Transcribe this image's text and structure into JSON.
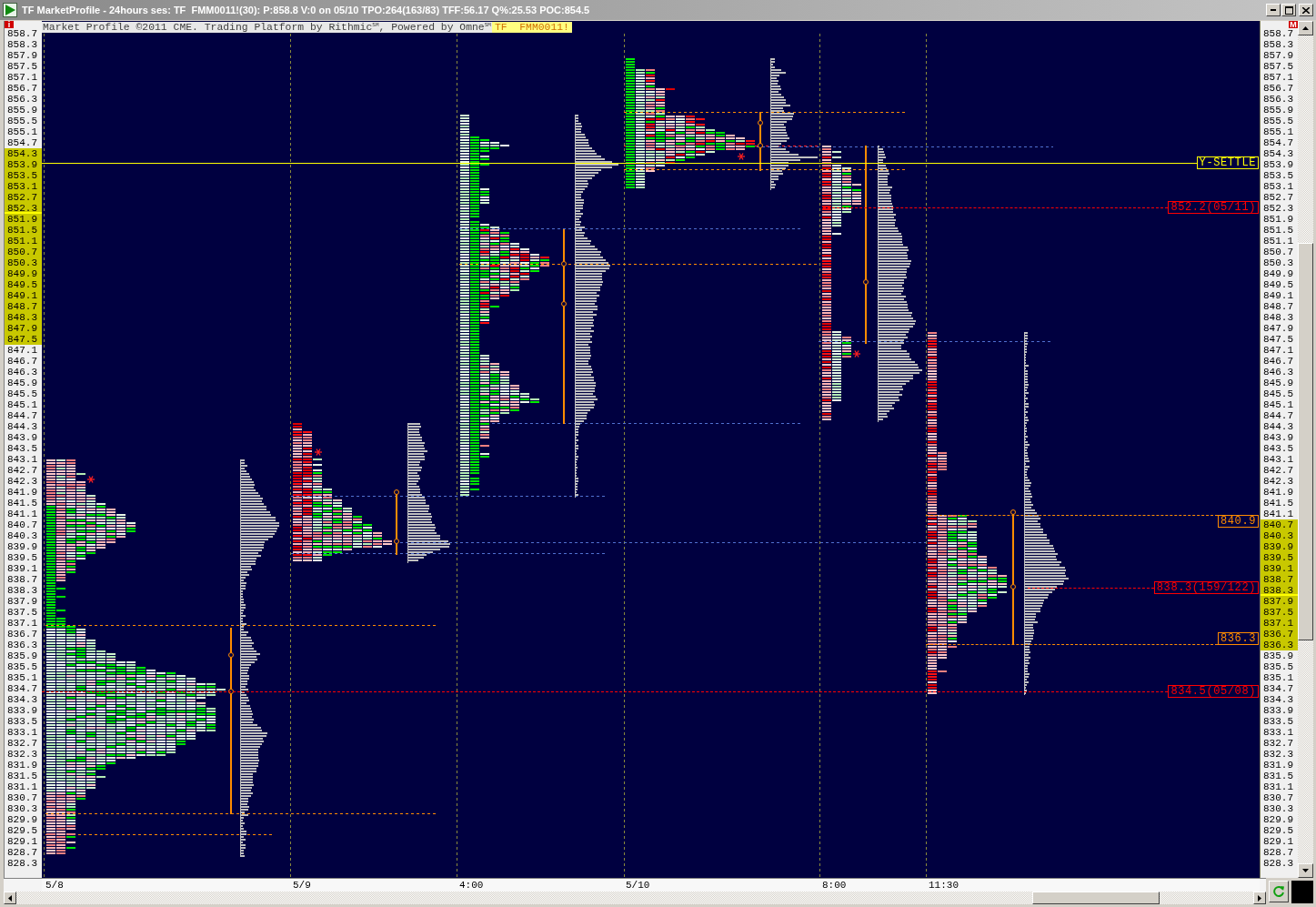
{
  "window": {
    "title": "TF MarketProfile - 24hours ses: TF  FMM0011!(30): P:858.8 V:0 on 05/10 TPO:264(163/83) TFF:56.17 Q%:25.53 POC:854.5"
  },
  "header": {
    "credit": "Market Profile ©2011 CME. Trading Platform by Rithmic$^{SM}$, Powered by Omne$^{SM}$",
    "symbol": "TF  FMM0011!"
  },
  "left_tag": "i",
  "right_tag": "M",
  "left_axis": [
    {
      "text": "858.7",
      "highlighted": false,
      "marked": false
    },
    {
      "text": "858.3",
      "highlighted": false,
      "marked": false
    },
    {
      "text": "857.9",
      "highlighted": false,
      "marked": false
    },
    {
      "text": "857.5",
      "highlighted": false,
      "marked": false
    },
    {
      "text": "857.1",
      "highlighted": false,
      "marked": false
    },
    {
      "text": "856.7",
      "highlighted": false,
      "marked": false
    },
    {
      "text": "856.3",
      "highlighted": false,
      "marked": false
    },
    {
      "text": "855.9",
      "highlighted": false,
      "marked": false
    },
    {
      "text": "855.5",
      "highlighted": false,
      "marked": false
    },
    {
      "text": "855.1",
      "highlighted": false,
      "marked": false
    },
    {
      "text": "854.7",
      "highlighted": false,
      "marked": false
    },
    {
      "text": "854.3",
      "highlighted": true,
      "marked": false
    },
    {
      "text": "853.9",
      "highlighted": true,
      "marked": false
    },
    {
      "text": "853.5",
      "highlighted": true,
      "marked": false
    },
    {
      "text": "853.1",
      "highlighted": true,
      "marked": false
    },
    {
      "text": "852.7",
      "highlighted": true,
      "marked": false
    },
    {
      "text": "852.3",
      "highlighted": true,
      "marked": true
    },
    {
      "text": "851.9",
      "highlighted": true,
      "marked": false
    },
    {
      "text": "851.5",
      "highlighted": true,
      "marked": false
    },
    {
      "text": "851.1",
      "highlighted": true,
      "marked": false
    },
    {
      "text": "850.7",
      "highlighted": true,
      "marked": false
    },
    {
      "text": "850.3",
      "highlighted": true,
      "marked": false
    },
    {
      "text": "849.9",
      "highlighted": true,
      "marked": false
    },
    {
      "text": "849.5",
      "highlighted": true,
      "marked": false
    },
    {
      "text": "849.1",
      "highlighted": true,
      "marked": false
    },
    {
      "text": "848.7",
      "highlighted": true,
      "marked": false
    },
    {
      "text": "848.3",
      "highlighted": true,
      "marked": false
    },
    {
      "text": "847.9",
      "highlighted": true,
      "marked": false
    },
    {
      "text": "847.5",
      "highlighted": true,
      "marked": false
    },
    {
      "text": "847.1",
      "highlighted": false,
      "marked": false
    },
    {
      "text": "846.7",
      "highlighted": false,
      "marked": false
    },
    {
      "text": "846.3",
      "highlighted": false,
      "marked": false
    },
    {
      "text": "845.9",
      "highlighted": false,
      "marked": false
    },
    {
      "text": "845.5",
      "highlighted": false,
      "marked": false
    },
    {
      "text": "845.1",
      "highlighted": false,
      "marked": false
    },
    {
      "text": "844.7",
      "highlighted": false,
      "marked": false
    },
    {
      "text": "844.3",
      "highlighted": false,
      "marked": false
    },
    {
      "text": "843.9",
      "highlighted": false,
      "marked": false
    },
    {
      "text": "843.5",
      "highlighted": false,
      "marked": false
    },
    {
      "text": "843.1",
      "highlighted": false,
      "marked": false
    },
    {
      "text": "842.7",
      "highlighted": false,
      "marked": false
    },
    {
      "text": "842.3",
      "highlighted": false,
      "marked": false
    },
    {
      "text": "841.9",
      "highlighted": false,
      "marked": false
    },
    {
      "text": "841.5",
      "highlighted": false,
      "marked": false
    },
    {
      "text": "841.1",
      "highlighted": false,
      "marked": false
    },
    {
      "text": "840.7",
      "highlighted": false,
      "marked": false
    },
    {
      "text": "840.3",
      "highlighted": false,
      "marked": false
    },
    {
      "text": "839.9",
      "highlighted": false,
      "marked": false
    },
    {
      "text": "839.5",
      "highlighted": false,
      "marked": false
    },
    {
      "text": "839.1",
      "highlighted": false,
      "marked": false
    },
    {
      "text": "838.7",
      "highlighted": false,
      "marked": false
    },
    {
      "text": "838.3",
      "highlighted": false,
      "marked": false
    },
    {
      "text": "837.9",
      "highlighted": false,
      "marked": false
    },
    {
      "text": "837.5",
      "highlighted": false,
      "marked": false
    },
    {
      "text": "837.1",
      "highlighted": false,
      "marked": false
    },
    {
      "text": "836.7",
      "highlighted": false,
      "marked": false
    },
    {
      "text": "836.3",
      "highlighted": false,
      "marked": false
    },
    {
      "text": "835.9",
      "highlighted": false,
      "marked": false
    },
    {
      "text": "835.5",
      "highlighted": false,
      "marked": false
    },
    {
      "text": "835.1",
      "highlighted": false,
      "marked": false
    },
    {
      "text": "834.7",
      "highlighted": false,
      "marked": false
    },
    {
      "text": "834.3",
      "highlighted": false,
      "marked": false
    },
    {
      "text": "833.9",
      "highlighted": false,
      "marked": false
    },
    {
      "text": "833.5",
      "highlighted": false,
      "marked": false
    },
    {
      "text": "833.1",
      "highlighted": false,
      "marked": false
    },
    {
      "text": "832.7",
      "highlighted": false,
      "marked": false
    },
    {
      "text": "832.3",
      "highlighted": false,
      "marked": false
    },
    {
      "text": "831.9",
      "highlighted": false,
      "marked": false
    },
    {
      "text": "831.5",
      "highlighted": false,
      "marked": false
    },
    {
      "text": "831.1",
      "highlighted": false,
      "marked": false
    },
    {
      "text": "830.7",
      "highlighted": false,
      "marked": false
    },
    {
      "text": "830.3",
      "highlighted": false,
      "marked": false
    },
    {
      "text": "829.9",
      "highlighted": false,
      "marked": false
    },
    {
      "text": "829.5",
      "highlighted": false,
      "marked": false
    },
    {
      "text": "829.1",
      "highlighted": false,
      "marked": false
    },
    {
      "text": "828.7",
      "highlighted": false,
      "marked": false
    },
    {
      "text": "828.3",
      "highlighted": false,
      "marked": false
    }
  ],
  "right_axis": [
    {
      "text": "858.7",
      "highlighted": false,
      "marked": false
    },
    {
      "text": "858.3",
      "highlighted": false,
      "marked": false
    },
    {
      "text": "857.9",
      "highlighted": false,
      "marked": false
    },
    {
      "text": "857.5",
      "highlighted": false,
      "marked": false
    },
    {
      "text": "857.1",
      "highlighted": false,
      "marked": false
    },
    {
      "text": "856.7",
      "highlighted": false,
      "marked": false
    },
    {
      "text": "856.3",
      "highlighted": false,
      "marked": false
    },
    {
      "text": "855.9",
      "highlighted": false,
      "marked": false
    },
    {
      "text": "855.5",
      "highlighted": false,
      "marked": false
    },
    {
      "text": "855.1",
      "highlighted": false,
      "marked": false
    },
    {
      "text": "854.7",
      "highlighted": false,
      "marked": false
    },
    {
      "text": "854.3",
      "highlighted": false,
      "marked": false
    },
    {
      "text": "853.9",
      "highlighted": false,
      "marked": false
    },
    {
      "text": "853.5",
      "highlighted": false,
      "marked": false
    },
    {
      "text": "853.1",
      "highlighted": false,
      "marked": false
    },
    {
      "text": "852.7",
      "highlighted": false,
      "marked": false
    },
    {
      "text": "852.3",
      "highlighted": false,
      "marked": false
    },
    {
      "text": "851.9",
      "highlighted": false,
      "marked": false
    },
    {
      "text": "851.5",
      "highlighted": false,
      "marked": false
    },
    {
      "text": "851.1",
      "highlighted": false,
      "marked": false
    },
    {
      "text": "850.7",
      "highlighted": false,
      "marked": false
    },
    {
      "text": "850.3",
      "highlighted": false,
      "marked": false
    },
    {
      "text": "849.9",
      "highlighted": false,
      "marked": false
    },
    {
      "text": "849.5",
      "highlighted": false,
      "marked": false
    },
    {
      "text": "849.1",
      "highlighted": false,
      "marked": false
    },
    {
      "text": "848.7",
      "highlighted": false,
      "marked": false
    },
    {
      "text": "848.3",
      "highlighted": false,
      "marked": false
    },
    {
      "text": "847.9",
      "highlighted": false,
      "marked": false
    },
    {
      "text": "847.5",
      "highlighted": false,
      "marked": false
    },
    {
      "text": "847.1",
      "highlighted": false,
      "marked": false
    },
    {
      "text": "846.7",
      "highlighted": false,
      "marked": false
    },
    {
      "text": "846.3",
      "highlighted": false,
      "marked": false
    },
    {
      "text": "845.9",
      "highlighted": false,
      "marked": false
    },
    {
      "text": "845.5",
      "highlighted": false,
      "marked": false
    },
    {
      "text": "845.1",
      "highlighted": false,
      "marked": false
    },
    {
      "text": "844.7",
      "highlighted": false,
      "marked": false
    },
    {
      "text": "844.3",
      "highlighted": false,
      "marked": false
    },
    {
      "text": "843.9",
      "highlighted": false,
      "marked": false
    },
    {
      "text": "843.5",
      "highlighted": false,
      "marked": false
    },
    {
      "text": "843.1",
      "highlighted": false,
      "marked": false
    },
    {
      "text": "842.7",
      "highlighted": false,
      "marked": false
    },
    {
      "text": "842.3",
      "highlighted": false,
      "marked": false
    },
    {
      "text": "841.9",
      "highlighted": false,
      "marked": false
    },
    {
      "text": "841.5",
      "highlighted": false,
      "marked": false
    },
    {
      "text": "841.1",
      "highlighted": false,
      "marked": false
    },
    {
      "text": "840.7",
      "highlighted": true,
      "marked": false
    },
    {
      "text": "840.3",
      "highlighted": true,
      "marked": false
    },
    {
      "text": "839.9",
      "highlighted": true,
      "marked": false
    },
    {
      "text": "839.5",
      "highlighted": true,
      "marked": false
    },
    {
      "text": "839.1",
      "highlighted": true,
      "marked": false
    },
    {
      "text": "838.7",
      "highlighted": true,
      "marked": false
    },
    {
      "text": "838.3",
      "highlighted": true,
      "marked": true
    },
    {
      "text": "837.9",
      "highlighted": true,
      "marked": false
    },
    {
      "text": "837.5",
      "highlighted": true,
      "marked": false
    },
    {
      "text": "837.1",
      "highlighted": true,
      "marked": false
    },
    {
      "text": "836.7",
      "highlighted": true,
      "marked": false
    },
    {
      "text": "836.3",
      "highlighted": true,
      "marked": false
    },
    {
      "text": "835.9",
      "highlighted": false,
      "marked": false
    },
    {
      "text": "835.5",
      "highlighted": false,
      "marked": false
    },
    {
      "text": "835.1",
      "highlighted": false,
      "marked": false
    },
    {
      "text": "834.7",
      "highlighted": false,
      "marked": false
    },
    {
      "text": "834.3",
      "highlighted": false,
      "marked": false
    },
    {
      "text": "833.9",
      "highlighted": false,
      "marked": false
    },
    {
      "text": "833.5",
      "highlighted": false,
      "marked": false
    },
    {
      "text": "833.1",
      "highlighted": false,
      "marked": false
    },
    {
      "text": "832.7",
      "highlighted": false,
      "marked": false
    },
    {
      "text": "832.3",
      "highlighted": false,
      "marked": false
    },
    {
      "text": "831.9",
      "highlighted": false,
      "marked": false
    },
    {
      "text": "831.5",
      "highlighted": false,
      "marked": false
    },
    {
      "text": "831.1",
      "highlighted": false,
      "marked": false
    },
    {
      "text": "830.7",
      "highlighted": false,
      "marked": false
    },
    {
      "text": "830.3",
      "highlighted": false,
      "marked": false
    },
    {
      "text": "829.9",
      "highlighted": false,
      "marked": false
    },
    {
      "text": "829.5",
      "highlighted": false,
      "marked": false
    },
    {
      "text": "829.1",
      "highlighted": false,
      "marked": false
    },
    {
      "text": "828.7",
      "highlighted": false,
      "marked": false
    },
    {
      "text": "828.3",
      "highlighted": false,
      "marked": false
    }
  ],
  "price_lines": [
    {
      "kind": "settle",
      "label": "Y-SETTLE",
      "color": "#ffff00"
    },
    {
      "kind": "level",
      "label": "852.2(05/11)",
      "color": "#ff0000"
    },
    {
      "kind": "level",
      "label": "840.9",
      "color": "#ff8c00"
    },
    {
      "kind": "level",
      "label": "838.3(159/122)",
      "color": "#ff0000"
    },
    {
      "kind": "level",
      "label": "836.3",
      "color": "#ff8c00"
    },
    {
      "kind": "level",
      "label": "834.5(05/08)",
      "color": "#ff0000"
    }
  ],
  "time_axis": [
    "5/8",
    "5/9",
    "4:00",
    "5/10",
    "8:00",
    "11:30"
  ]
}
